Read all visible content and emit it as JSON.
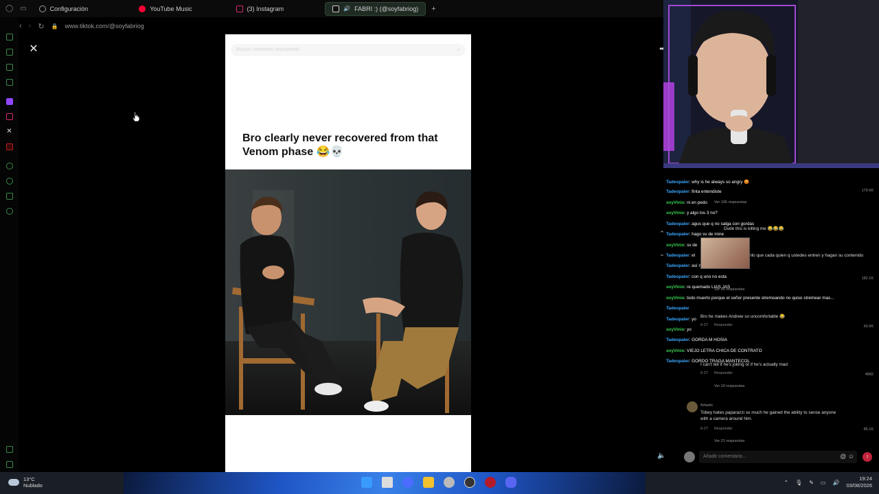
{
  "tabs": [
    {
      "label": "Configuración",
      "icon": "gear-icon",
      "color": "#9aa0a6"
    },
    {
      "label": "YouTube Music",
      "icon": "youtube-music-icon",
      "color": "#ff0033"
    },
    {
      "label": "(3) Instagram",
      "icon": "instagram-icon",
      "color": "#d62976"
    },
    {
      "label": "FABRI :) (@soyfabriog)",
      "icon": "tiktok-icon",
      "color": "#ffffff"
    }
  ],
  "address": {
    "url": "www.tiktok.com/@soyfabriog"
  },
  "video": {
    "search_placeholder": "Buscar contenido relacionado",
    "caption": "Bro clearly never recovered from that Venom phase 😂💀"
  },
  "chat": [
    {
      "user": "Tadeopaler",
      "text": ": why is he always so angry 😡",
      "user_color": "blue"
    },
    {
      "user": "Tadeopaler",
      "text": ": finta entendiste",
      "user_color": "blue"
    },
    {
      "user": "soyVinio",
      "text": ": ni en pedo",
      "user_color": "green"
    },
    {
      "user": "soyVinio",
      "text": ": y algo los 3 no?",
      "user_color": "green"
    },
    {
      "user": "Tadeopaler",
      "text": ": agus que q no salga con gordas",
      "user_color": "blue"
    },
    {
      "user": "Tadeopaler",
      "text": ": hago sv de mine",
      "user_color": "blue"
    },
    {
      "user": "soyVinio",
      "text": ": sv de",
      "user_color": "green"
    },
    {
      "user": "Tadeopaler",
      "text": ": el",
      "user_color": "blue"
    },
    {
      "user": "Tadeopaler",
      "text": ": así me rompe",
      "user_color": "blue"
    },
    {
      "user": "Tadeopaler",
      "text": ": con q uno no esta",
      "user_color": "blue"
    },
    {
      "user": "soyVinio",
      "text": ": re quemado LIAS JAS",
      "user_color": "green"
    },
    {
      "user": "soyVinio",
      "text": ": todo muerto porque el señor presente stremoando no quiso stremear mas...",
      "user_color": "green"
    },
    {
      "user": "Tadeopaler",
      "text": "",
      "user_color": "blue"
    },
    {
      "user": "Tadeopaler",
      "text": ": yo",
      "user_color": "blue"
    },
    {
      "user": "soyVinio",
      "text": ": yo",
      "user_color": "green"
    },
    {
      "user": "Tadeopaler",
      "text": ": GORDA M HOSIA",
      "user_color": "blue"
    },
    {
      "user": "soyVinio",
      "text": ": VIEJO LETRA CHICA DE CONTRATO",
      "user_color": "green"
    },
    {
      "user": "Tadeopaler",
      "text": ": GORDO TRAGA MANTECOL",
      "user_color": "blue"
    }
  ],
  "comments": {
    "replies_1": "Ver 106 respuestas",
    "overlay_1": "Dude this is killing me 😂😂😂",
    "overlay_2": "Déjenlo que cada quien q ustedes entren y hagan su contenido",
    "replies_2": "Ver 80 respuestas",
    "c3_text": "Bro he makes Andrew so uncomfortable 😂",
    "c4_text": "I can't tell if he's joking or if he's actually mad",
    "replies_3": "Ver 10 respuestas",
    "c5_user": "Artastic",
    "c5_text": "Tobey hates paparazzi so much he gained the ability to sense anyone with a camera around him.",
    "replies_4": "Ver 21 respuestas",
    "reply_label": "Responder",
    "date": "6-27",
    "likes": [
      "179.5K",
      "182.1K",
      "93.6K",
      "4882",
      "85.1K"
    ],
    "input_placeholder": "Añadir comentario..."
  },
  "taskbar": {
    "temp": "13°C",
    "weather": "Nublado",
    "time": "19:24",
    "date": "03/08/2026"
  }
}
